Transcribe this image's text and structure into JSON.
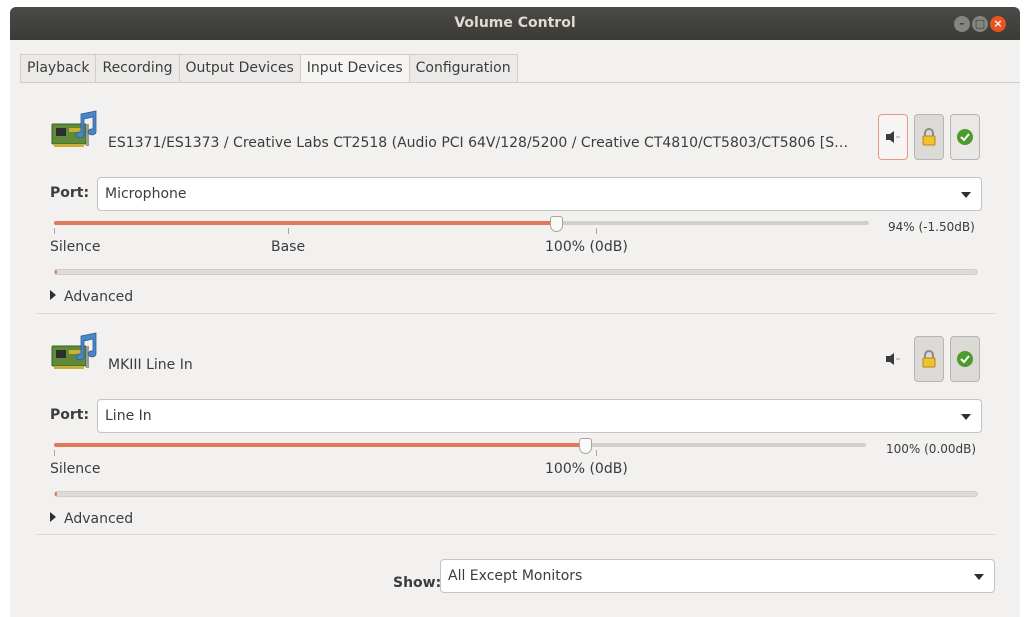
{
  "window": {
    "title": "Volume Control",
    "buttons": {
      "minimize": "–",
      "maximize": "□",
      "close": "×"
    }
  },
  "tabs": [
    {
      "label": "Playback",
      "active": false
    },
    {
      "label": "Recording",
      "active": false
    },
    {
      "label": "Output Devices",
      "active": false
    },
    {
      "label": "Input Devices",
      "active": true
    },
    {
      "label": "Configuration",
      "active": false
    }
  ],
  "devices": [
    {
      "name": "ES1371/ES1373 / Creative Labs CT2518 (Audio PCI 64V/128/5200 / Creative CT4810/CT5803/CT5806 [S…",
      "icon": "sound-card-icon",
      "port_label": "Port:",
      "port_value": "Microphone",
      "volume_percent": 94,
      "volume_readout": "94% (-1.50dB)",
      "marks": {
        "silence": "Silence",
        "base": "Base",
        "hundred": "100% (0dB)"
      },
      "advanced_label": "Advanced",
      "mute_active": true,
      "lock_active": true,
      "default_active": false
    },
    {
      "name": "MKIII Line In",
      "icon": "sound-card-icon",
      "port_label": "Port:",
      "port_value": "Line In",
      "volume_percent": 100,
      "volume_readout": "100% (0.00dB)",
      "marks": {
        "silence": "Silence",
        "hundred": "100% (0dB)"
      },
      "advanced_label": "Advanced",
      "mute_active": false,
      "lock_active": true,
      "default_active": true
    }
  ],
  "footer": {
    "show_label": "Show:",
    "show_value": "All Except Monitors"
  },
  "colors": {
    "accent": "#e0795a",
    "titlebar": "#3b3a37",
    "close_button": "#e95420"
  }
}
